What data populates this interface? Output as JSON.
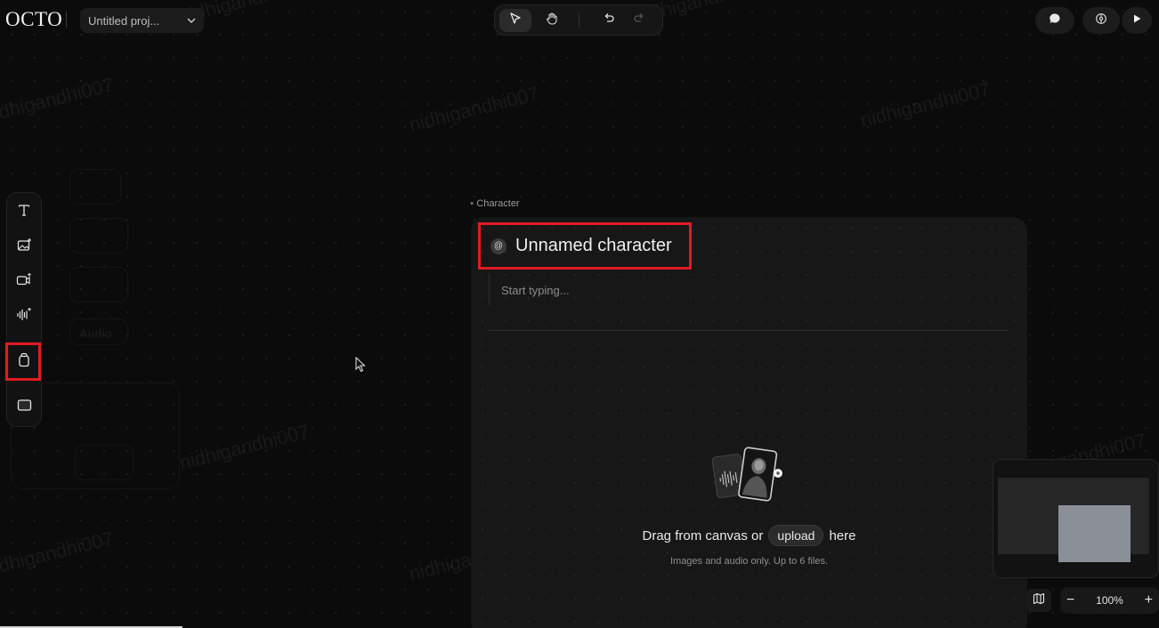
{
  "app": {
    "logo": "OCTO"
  },
  "project": {
    "title": "Untitled proj..."
  },
  "watermarks": [
    "nidhigandhi007"
  ],
  "character_card": {
    "section_label": "Character",
    "name": "Unnamed character",
    "at_symbol": "@",
    "description_placeholder": "Start typing...",
    "drop_prefix": "Drag from canvas or",
    "upload_label": "upload",
    "drop_suffix": "here",
    "drop_hint": "Images and audio only. Up to 6 files."
  },
  "zoom": {
    "level": "100%",
    "minus": "−",
    "plus": "+"
  },
  "ghost_label": "Audio",
  "colors": {
    "highlight": "#e01b24",
    "background": "#0b0b0b",
    "card": "#171717"
  },
  "icons": {
    "top_tools": [
      "select-pointer-icon",
      "hand-pan-icon",
      "undo-icon",
      "redo-icon"
    ],
    "top_right": [
      "chat-icon",
      "settings-icon",
      "play-icon"
    ],
    "left_toolbar": [
      "text-tool-icon",
      "image-tool-icon",
      "video-tool-icon",
      "audio-tool-icon",
      "character-tool-icon",
      "frame-tool-icon"
    ]
  }
}
